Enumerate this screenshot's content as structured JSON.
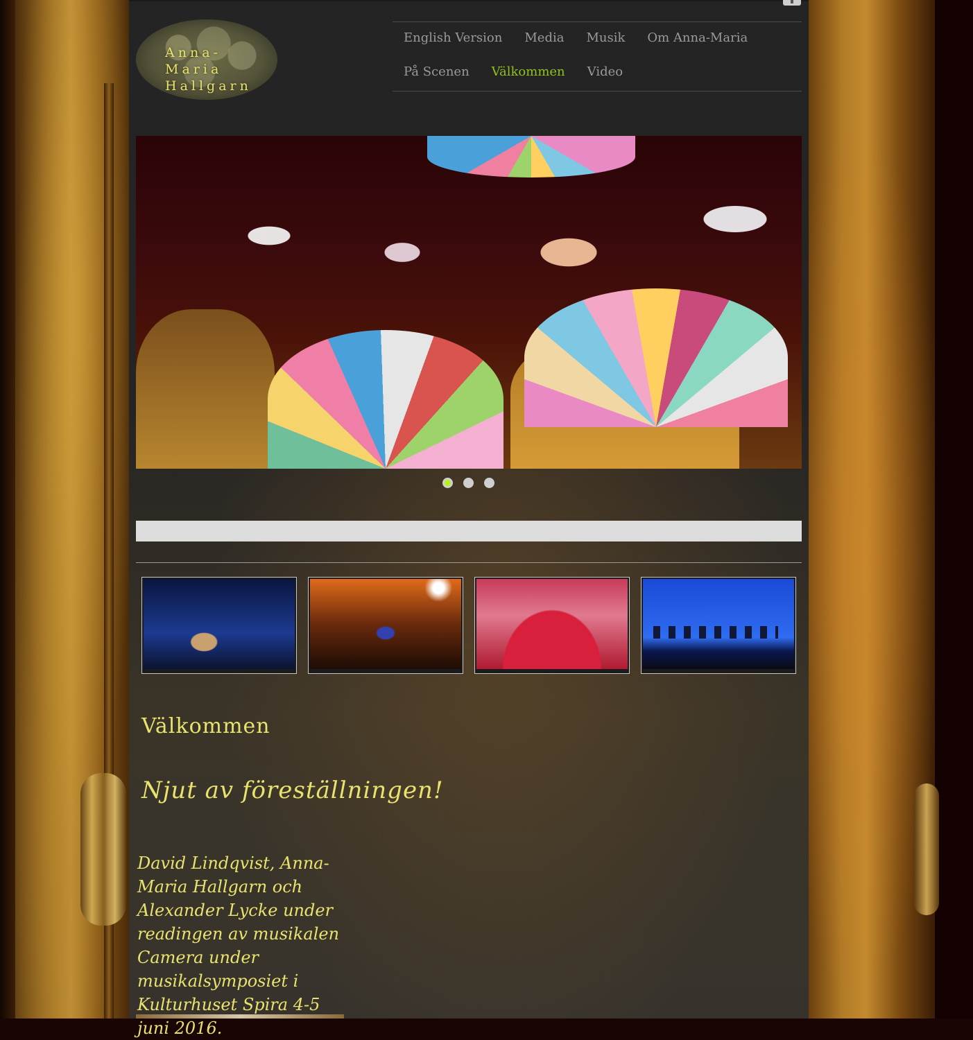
{
  "brand": {
    "logo_line1": "Anna-Maria",
    "logo_line2": "Hallgarn"
  },
  "nav": {
    "items": [
      {
        "label": "English Version",
        "active": false
      },
      {
        "label": "Media",
        "active": false
      },
      {
        "label": "Musik",
        "active": false
      },
      {
        "label": "Om Anna-Maria",
        "active": false
      },
      {
        "label": "På Scenen",
        "active": false
      },
      {
        "label": "Välkommen",
        "active": true
      },
      {
        "label": "Video",
        "active": false
      }
    ]
  },
  "slider": {
    "slide_count": 3,
    "active_index": 0,
    "image": "theatre-performers-with-fans-and-masks"
  },
  "thumbnails": [
    {
      "image": "stage-blue-ensemble"
    },
    {
      "image": "stage-orange-dancers"
    },
    {
      "image": "stage-pink-chorus-line"
    },
    {
      "image": "stage-blue-seated-cast"
    }
  ],
  "content": {
    "heading": "Välkommen",
    "subheading": "Njut av föreställningen!",
    "body": "David Lindqvist, Anna-Maria Hallgarn och Alexander Lycke under readingen av musikalen Camera under musikalsymposiet i Kulturhuset Spira 4-5 juni 2016."
  },
  "colors": {
    "accent": "#8fc21b",
    "text_gold": "#e9e36e",
    "nav_text": "#9a9a9a",
    "panel": "#242424"
  }
}
